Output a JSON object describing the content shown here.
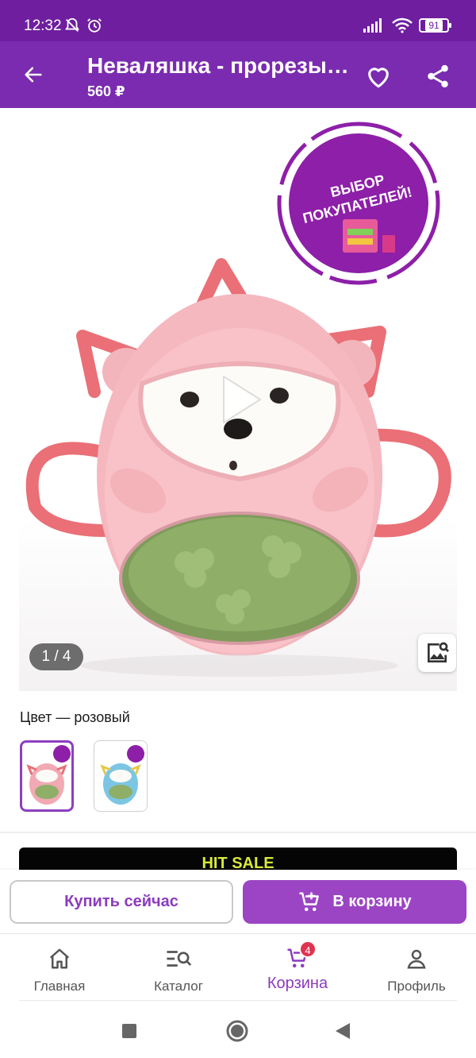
{
  "status_bar": {
    "time": "12:32",
    "battery": "91"
  },
  "app_bar": {
    "title": "Неваляшка - прорезыватель",
    "price": "560 ₽"
  },
  "gallery": {
    "badge_text": "ВЫБОР ПОКУПАТЕЛЕЙ!",
    "page_indicator": "1 / 4"
  },
  "product": {
    "color_label": "Цвет — розовый",
    "swatches": [
      {
        "name": "pink",
        "color": "#f2a9b3",
        "selected": true
      },
      {
        "name": "blue",
        "color": "#7cc6e3",
        "selected": false
      }
    ]
  },
  "promo": {
    "banner_text": "HIT SALE"
  },
  "actions": {
    "buy_now_label": "Купить сейчас",
    "add_to_cart_label": "В корзину"
  },
  "bottom_nav": {
    "items": [
      {
        "label": "Главная",
        "icon": "home-icon"
      },
      {
        "label": "Каталог",
        "icon": "catalog-search-icon"
      },
      {
        "label": "Корзина",
        "icon": "cart-icon",
        "badge": "4",
        "active": true
      },
      {
        "label": "Профиль",
        "icon": "profile-icon"
      }
    ]
  },
  "colors": {
    "brand": "#7a2bb0",
    "accent": "#9b45c4",
    "promo_text": "#d9ea3b",
    "badge": "#e0334f"
  }
}
